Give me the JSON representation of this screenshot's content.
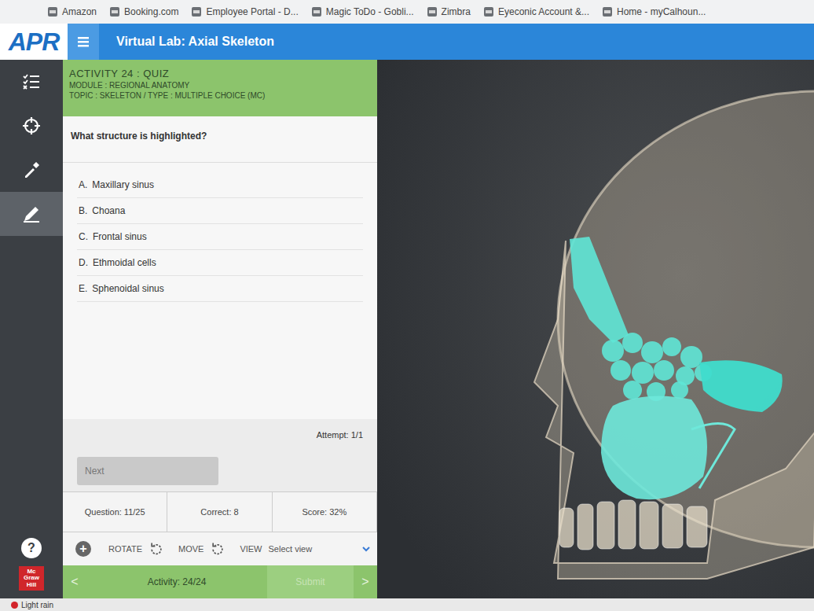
{
  "bookmarks": [
    {
      "label": "Amazon"
    },
    {
      "label": "Booking.com"
    },
    {
      "label": "Employee Portal - D..."
    },
    {
      "label": "Magic ToDo - Gobli..."
    },
    {
      "label": "Zimbra"
    },
    {
      "label": "Eyeconic Account &..."
    },
    {
      "label": "Home - myCalhoun..."
    }
  ],
  "app": {
    "logo": "APR",
    "title": "Virtual Lab: Axial Skeleton"
  },
  "rail": [
    {
      "kind": "list",
      "selected": false
    },
    {
      "kind": "target",
      "selected": false
    },
    {
      "kind": "dropper",
      "selected": false
    },
    {
      "kind": "pencil",
      "selected": true
    }
  ],
  "rail_bottom": {
    "help": "?",
    "brand": [
      "Mc",
      "Graw",
      "Hill"
    ]
  },
  "activity": {
    "title": "ACTIVITY 24 : QUIZ",
    "module": "MODULE : REGIONAL ANATOMY",
    "topic": "TOPIC : SKELETON / TYPE : MULTIPLE CHOICE (MC)"
  },
  "question": "What structure is highlighted?",
  "options": [
    {
      "letter": "A.",
      "text": "Maxillary sinus",
      "selected": false
    },
    {
      "letter": "B.",
      "text": "Choana",
      "selected": false
    },
    {
      "letter": "C.",
      "text": "Frontal sinus",
      "selected": false
    },
    {
      "letter": "D.",
      "text": "Ethmoidal cells",
      "selected": false
    },
    {
      "letter": "E.",
      "text": "Sphenoidal sinus",
      "selected": false
    }
  ],
  "attempt": "Attempt: 1/1",
  "next": {
    "label": "Next",
    "disabled": true
  },
  "stats": [
    "Question: 11/25",
    "Correct: 8",
    "Score: 32%"
  ],
  "toolbar": {
    "add": "+",
    "rotate": "ROTATE",
    "move": "MOVE",
    "view": "VIEW",
    "select": "Select view"
  },
  "footer": {
    "prev": "<",
    "activity": "Activity: 24/24",
    "submit": {
      "label": "Submit",
      "disabled": true
    },
    "next": ">"
  },
  "taskbar": {
    "weather": "Light rain"
  }
}
